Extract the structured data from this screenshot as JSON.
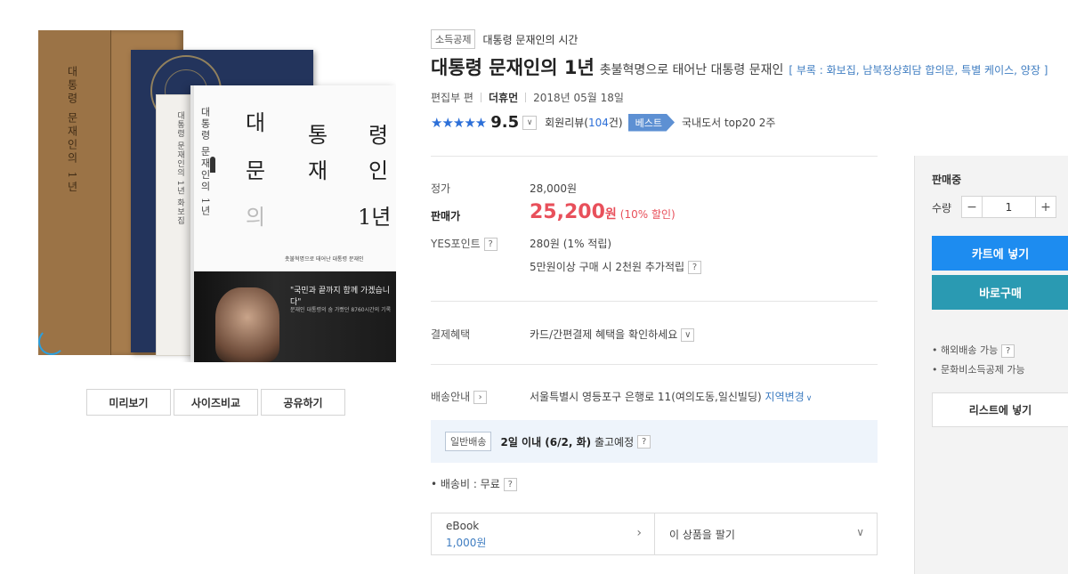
{
  "image_buttons": [
    "미리보기",
    "사이즈비교",
    "공유하기"
  ],
  "book_cover": {
    "box_title_v": "대통령 문재인의 1년",
    "white_spine_v": "대통령 문재인의 1년 화보집",
    "main_chars": [
      "대",
      "통",
      "령",
      "문",
      "재",
      "인",
      "의",
      "1년"
    ],
    "main_vertical": "대통령 문재인의 1년",
    "tagline": "촛불혁명으로 태어난 대통령 문재인",
    "quote": "\"국민과 끝까지 함께 가겠습니다\"",
    "quote_sub": "문재인 대통령의 숨 가빴던 8760시간의 기록"
  },
  "tag_chip": "소득공제",
  "series": "대통령 문재인의 시간",
  "title": "대통령 문재인의 1년",
  "subtitle": "촛불혁명으로 태어난 대통령 문재인",
  "supplement": "[ 부록 : 화보집, 남북정상회담 합의문, 특별 케이스, 양장 ]",
  "meta": {
    "author": "편집부 편",
    "publisher": "더휴먼",
    "date": "2018년 05월 18일"
  },
  "rating": {
    "stars": "★★★★★",
    "score": "9.5",
    "dropdown": "∨",
    "review_prefix": "회원리뷰(",
    "review_count": "104",
    "review_suffix": "건)",
    "badge": "베스트",
    "rank": "국내도서 top20 2주"
  },
  "price": {
    "list_label": "정가",
    "list_value": "28,000원",
    "sale_label": "판매가",
    "sale_value": "25,200",
    "sale_unit": "원",
    "sale_discount": "(10% 할인)",
    "points_label": "YES포인트",
    "points_value": "280원 (1% 적립)",
    "points_extra": "5만원이상 구매 시 2천원 추가적립"
  },
  "payment": {
    "label": "결제혜택",
    "value": "카드/간편결제 혜택을 확인하세요"
  },
  "shipping": {
    "label": "배송안내",
    "address": "서울특별시 영등포구 은행로 11(여의도동,일신빌딩)",
    "change": "지역변경",
    "chip": "일반배송",
    "eta_bold": "2일 이내 (6/2, 화)",
    "eta_rest": "출고예정",
    "fee": "• 배송비 : 무료"
  },
  "ebook": {
    "title": "eBook",
    "price": "1,000원",
    "sell": "이 상품을 팔기"
  },
  "side": {
    "status": "판매중",
    "qty_label": "수량",
    "qty": "1",
    "minus": "−",
    "plus": "+",
    "cart": "카트에 넣기",
    "buy": "바로구매",
    "notes": [
      "• 해외배송 가능",
      "• 문화비소득공제 가능"
    ],
    "list": "리스트에 넣기"
  },
  "icons": {
    "question": "?",
    "chevron_right": "›",
    "chevron_down": "∨",
    "dropdown_small": "∨"
  },
  "colors": {
    "accent_blue": "#1d8cf0",
    "buy_teal": "#2a9ab2",
    "sale_red": "#e8505b",
    "link_blue": "#3f7dc1",
    "star_blue": "#2c6fd8"
  }
}
